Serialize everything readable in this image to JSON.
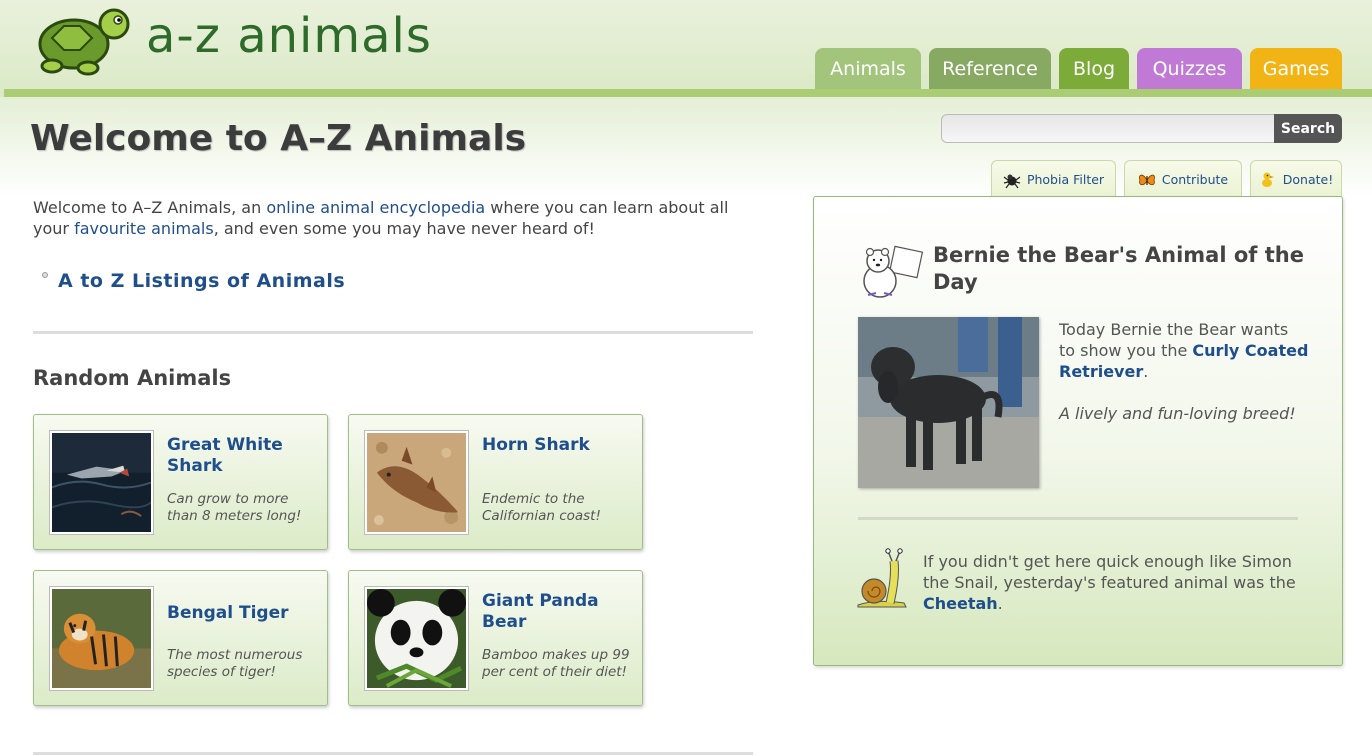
{
  "site": {
    "title": "a-z animals"
  },
  "nav": {
    "tabs": [
      {
        "label": "Animals",
        "color": "#a3c57b"
      },
      {
        "label": "Reference",
        "color": "#87a962"
      },
      {
        "label": "Blog",
        "color": "#7cab39"
      },
      {
        "label": "Quizzes",
        "color": "#c07ad6"
      },
      {
        "label": "Games",
        "color": "#f2b414"
      }
    ]
  },
  "search": {
    "placeholder": "",
    "button_label": "Search"
  },
  "tools": {
    "phobia": {
      "label": "Phobia Filter",
      "icon": "spider-icon"
    },
    "contribute": {
      "label": "Contribute",
      "icon": "butterfly-icon"
    },
    "donate": {
      "label": "Donate!",
      "icon": "duck-icon"
    }
  },
  "main": {
    "title": "Welcome to A–Z Animals",
    "intro": {
      "part1": "Welcome to A–Z Animals, an ",
      "link1": "online animal encyclopedia",
      "part2": " where you can learn about all your ",
      "link2": "favourite animals",
      "part3": ", and even some you may have never heard of!"
    },
    "az_link": "A to Z Listings of Animals",
    "random_title": "Random Animals",
    "cards": [
      {
        "name": "Great White Shark",
        "desc": "Can grow to more than 8 meters long!"
      },
      {
        "name": "Horn Shark",
        "desc": "Endemic to the Californian coast!"
      },
      {
        "name": "Bengal Tiger",
        "desc": "The most numerous species of tiger!"
      },
      {
        "name": "Giant Panda Bear",
        "desc": "Bamboo makes up 99 per cent of their diet!"
      }
    ]
  },
  "aotd": {
    "title": "Bernie the Bear's Animal of the Day",
    "text_pre": "Today Bernie the Bear wants to show you the ",
    "animal": "Curly Coated Retriever",
    "text_post": ".",
    "tagline": "A lively and fun-loving breed!",
    "yesterday_pre": "If you didn't get here quick enough like Simon the Snail, yesterday's featured animal was the ",
    "yesterday_animal": "Cheetah",
    "yesterday_post": "."
  }
}
